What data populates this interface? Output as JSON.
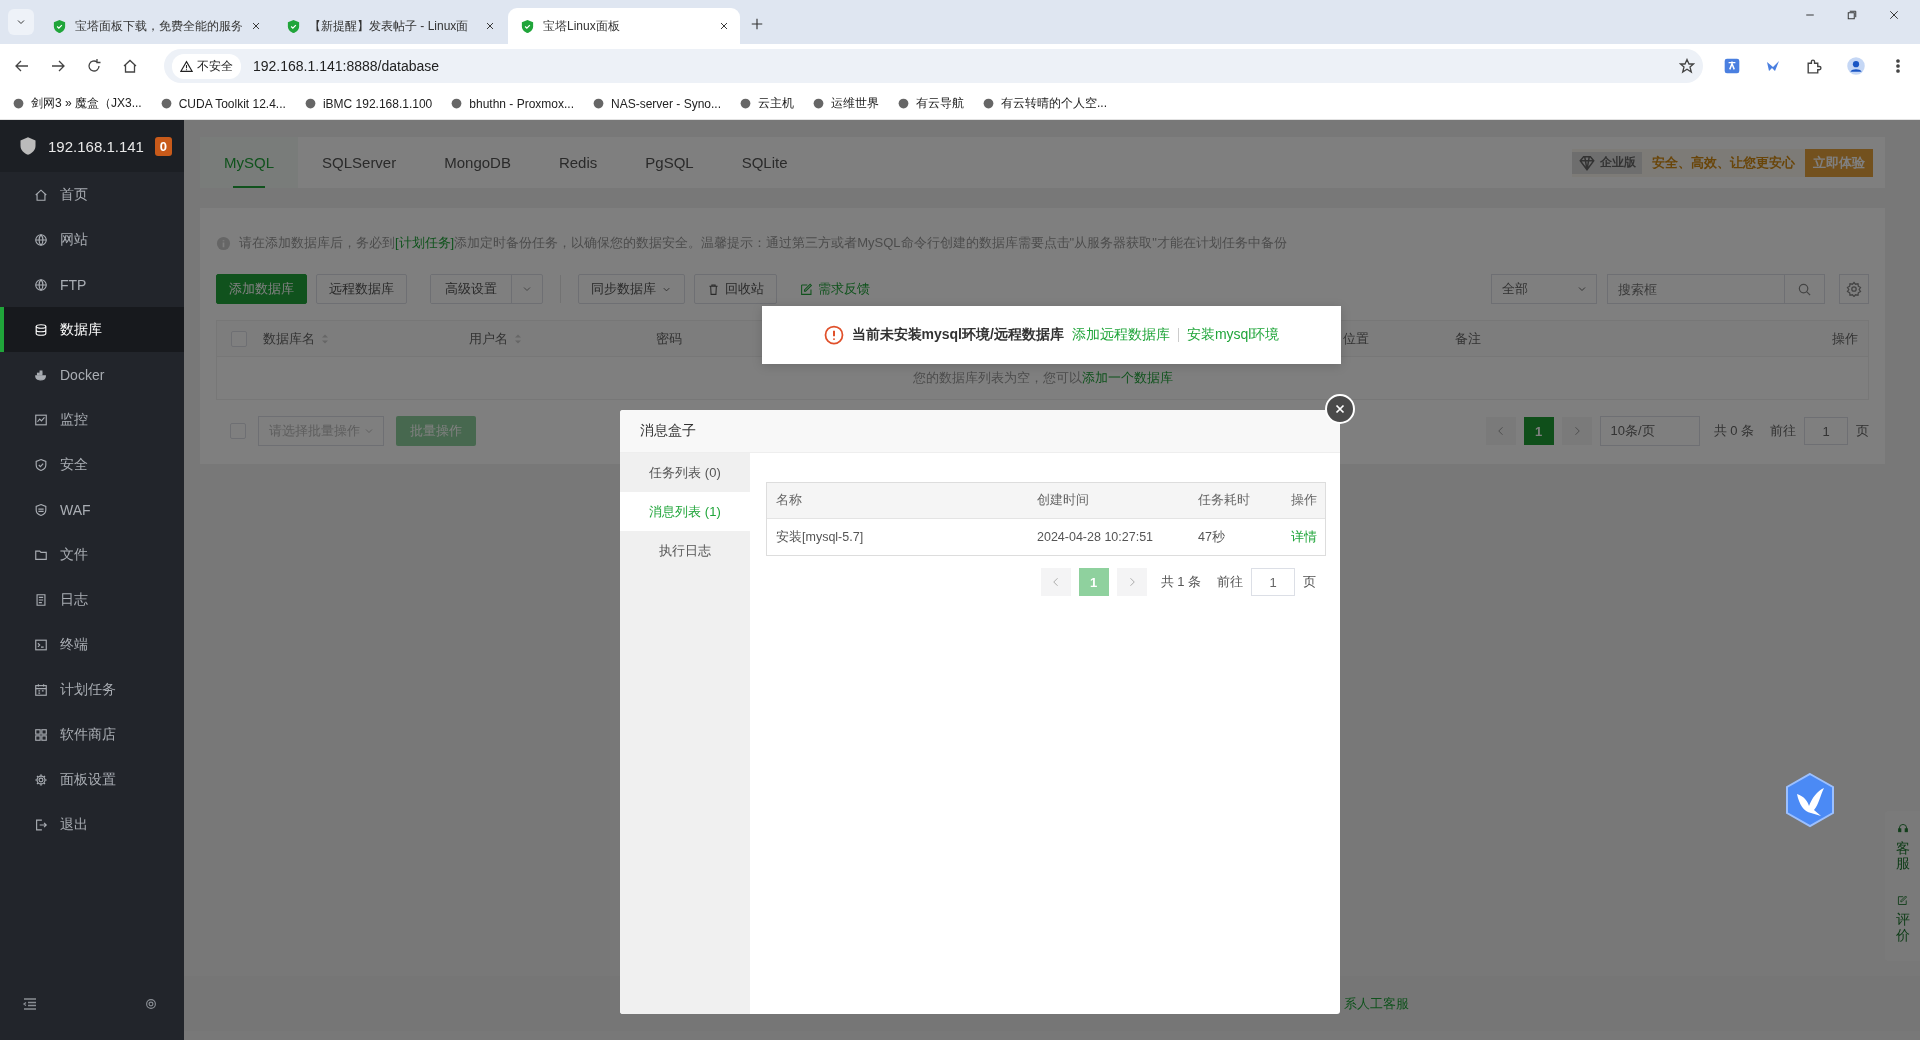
{
  "browser": {
    "tabs": [
      {
        "title": "宝塔面板下载，免费全能的服务",
        "selected": false
      },
      {
        "title": "【新提醒】发表帖子 - Linux面",
        "selected": false
      },
      {
        "title": "宝塔Linux面板",
        "selected": true
      }
    ],
    "security_label": "不安全",
    "url": "192.168.1.141:8888/database",
    "bookmarks": [
      "剑网3 » 魔盒（JX3...",
      "CUDA Toolkit 12.4...",
      "iBMC 192.168.1.100",
      "bhuthn - Proxmox...",
      "NAS-server - Syno...",
      "云主机",
      "运维世界",
      "有云导航",
      "有云转晴的个人空..."
    ]
  },
  "sidebar": {
    "host": "192.168.1.141",
    "badge": "0",
    "items": [
      {
        "label": "首页",
        "selected": false
      },
      {
        "label": "网站",
        "selected": false
      },
      {
        "label": "FTP",
        "selected": false
      },
      {
        "label": "数据库",
        "selected": true
      },
      {
        "label": "Docker",
        "selected": false
      },
      {
        "label": "监控",
        "selected": false
      },
      {
        "label": "安全",
        "selected": false
      },
      {
        "label": "WAF",
        "selected": false
      },
      {
        "label": "文件",
        "selected": false
      },
      {
        "label": "日志",
        "selected": false
      },
      {
        "label": "终端",
        "selected": false
      },
      {
        "label": "计划任务",
        "selected": false
      },
      {
        "label": "软件商店",
        "selected": false
      },
      {
        "label": "面板设置",
        "selected": false
      },
      {
        "label": "退出",
        "selected": false
      }
    ]
  },
  "db_tabs": [
    {
      "label": "MySQL",
      "selected": true
    },
    {
      "label": "SQLServer",
      "selected": false
    },
    {
      "label": "MongoDB",
      "selected": false
    },
    {
      "label": "Redis",
      "selected": false
    },
    {
      "label": "PgSQL",
      "selected": false
    },
    {
      "label": "SQLite",
      "selected": false
    }
  ],
  "promo": {
    "edition": "企业版",
    "slogan": "安全、高效、让您更安心",
    "button": "立即体验"
  },
  "notice": {
    "before": "请在添加数据库后，务必到",
    "link": "[计划任务]",
    "after": "添加定时备份任务，以确保您的数据安全。温馨提示：通过第三方或者MySQL命令行创建的数据库需要点击\"从服务器获取\"才能在计划任务中备份"
  },
  "toolbar": {
    "add": "添加数据库",
    "remote": "远程数据库",
    "advanced": "高级设置",
    "sync": "同步数据库",
    "recycle": "回收站",
    "feedback": "需求反馈",
    "filter": "全部",
    "search_placeholder": "搜索框"
  },
  "table": {
    "checked": false,
    "columns": [
      {
        "label": "数据库名",
        "sortable": true
      },
      {
        "label": "用户名",
        "sortable": true
      },
      {
        "label": "密码",
        "sortable": false
      },
      {
        "label": "位置",
        "sortable": false
      },
      {
        "label": "备注",
        "sortable": false
      },
      {
        "label": "操作",
        "sortable": false
      }
    ],
    "empty_text": "您的数据库列表为空，您可以",
    "empty_link": "添加一个数据库"
  },
  "batch": {
    "checked": false,
    "select_placeholder": "请选择批量操作",
    "button": "批量操作"
  },
  "pagination": {
    "pages": [
      {
        "label": "1",
        "selected": true
      }
    ],
    "page_size": "10条/页",
    "total": "共 0 条",
    "goto": "前往",
    "page_input": "1",
    "page_unit": "页"
  },
  "alert": {
    "message": "当前未安装mysql环境/远程数据库",
    "links": [
      "添加远程数据库",
      "安装mysql环境"
    ]
  },
  "footer": {
    "text": "系人工客服"
  },
  "side_widget": [
    "客服",
    "评价"
  ],
  "modal": {
    "title": "消息盒子",
    "nav": [
      {
        "label": "任务列表 (0)",
        "selected": false
      },
      {
        "label": "消息列表 (1)",
        "selected": true
      },
      {
        "label": "执行日志",
        "selected": false
      }
    ],
    "table": {
      "columns": [
        "名称",
        "创建时间",
        "任务耗时",
        "操作"
      ],
      "rows": [
        {
          "name": "安装[mysql-5.7]",
          "created": "2024-04-28 10:27:51",
          "duration": "47秒",
          "action": "详情"
        }
      ]
    },
    "pagination": {
      "pages": [
        {
          "label": "1",
          "selected": true
        }
      ],
      "total": "共 1 条",
      "goto": "前往",
      "page_input": "1",
      "page_unit": "页"
    }
  }
}
